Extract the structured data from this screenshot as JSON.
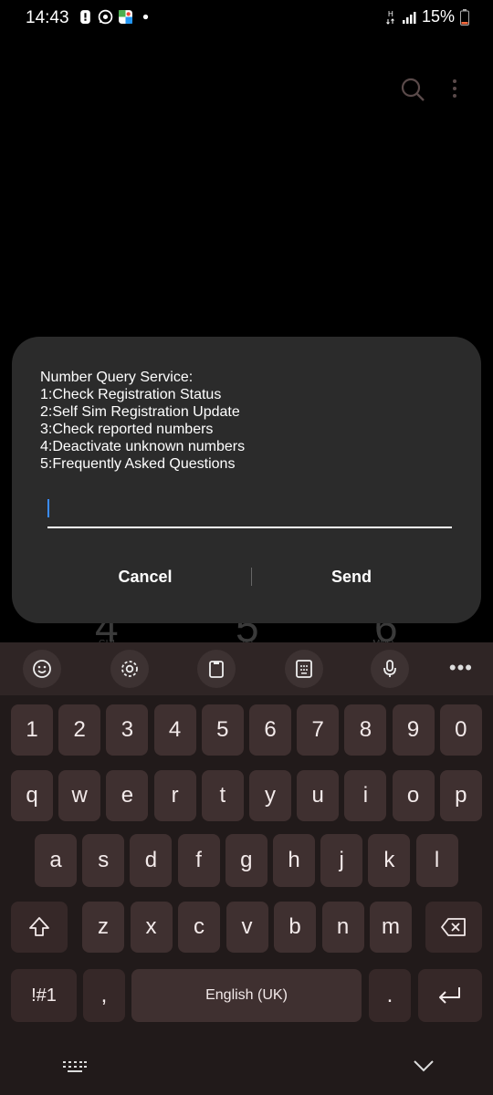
{
  "status_bar": {
    "time": "14:43",
    "battery": "15%",
    "left_icons": [
      "alert-icon",
      "whatsapp-icon",
      "maps-icon",
      "dot-icon"
    ],
    "right_icons": [
      "data-icon",
      "signal-icon",
      "battery-icon"
    ]
  },
  "top_bar": {
    "icons": [
      "search-icon",
      "more-icon"
    ]
  },
  "background": {
    "dialpad_digits": [
      "4",
      "5",
      "6"
    ],
    "dialpad_letters": [
      "GHI",
      "JKL",
      "MNO"
    ]
  },
  "dialog": {
    "message": "Number Query Service:\n1:Check Registration Status\n2:Self Sim Registration Update\n3:Check reported numbers\n4:Deactivate unknown numbers\n5:Frequently Asked Questions",
    "input_value": "",
    "cancel_label": "Cancel",
    "send_label": "Send"
  },
  "keyboard": {
    "toolbar": [
      "emoji-icon",
      "settings-icon",
      "clipboard-icon",
      "keypad-icon",
      "mic-icon",
      "more-icon"
    ],
    "more_label": "•••",
    "row_numbers": [
      "1",
      "2",
      "3",
      "4",
      "5",
      "6",
      "7",
      "8",
      "9",
      "0"
    ],
    "row_top": [
      "q",
      "w",
      "e",
      "r",
      "t",
      "y",
      "u",
      "i",
      "o",
      "p"
    ],
    "row_middle": [
      "a",
      "s",
      "d",
      "f",
      "g",
      "h",
      "j",
      "k",
      "l"
    ],
    "row_bottom": [
      "z",
      "x",
      "c",
      "v",
      "b",
      "n",
      "m"
    ],
    "symbols_label": "!#1",
    "comma_label": ",",
    "space_label": "English (UK)",
    "period_label": ".",
    "shift_icon": "shift-icon",
    "backspace_icon": "backspace-icon",
    "enter_icon": "enter-icon"
  },
  "nav_bar": {
    "icons": [
      "keyboard-switch-icon",
      "hide-keyboard-icon"
    ]
  },
  "colors": {
    "dialog_bg": "#2b2b2b",
    "keyboard_bg": "#211a1a",
    "key_bg": "#3f3030",
    "cursor": "#3a8cff"
  }
}
